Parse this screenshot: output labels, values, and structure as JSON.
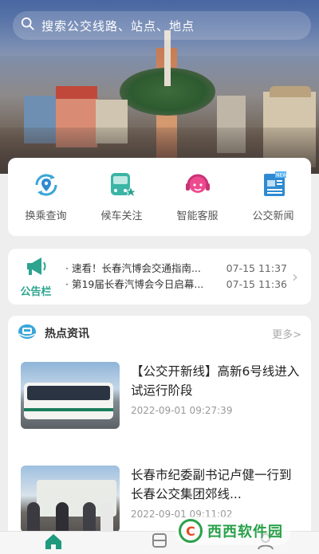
{
  "search": {
    "placeholder": "搜索公交线路、站点、地点"
  },
  "quick_actions": [
    {
      "label": "换乘查询",
      "icon": "transfer-location-icon"
    },
    {
      "label": "候车关注",
      "icon": "bus-star-icon"
    },
    {
      "label": "智能客服",
      "icon": "headset-service-icon"
    },
    {
      "label": "公交新闻",
      "icon": "newspaper-icon"
    }
  ],
  "notice": {
    "label": "公告栏",
    "items": [
      {
        "text": "· 速看！长春汽博会交通指南...",
        "time": "07-15 11:37"
      },
      {
        "text": "· 第19届长春汽博会今日启幕...",
        "time": "07-15 11:36"
      }
    ]
  },
  "news": {
    "title": "热点资讯",
    "more": "更多>",
    "items": [
      {
        "headline": "【公交开新线】高新6号线进入试运行阶段",
        "date": "2022-09-01 09:27:39"
      },
      {
        "headline": "长春市纪委副书记卢健一行到长春公交集团郊线...",
        "date": "2022-09-01 09:11:02"
      }
    ]
  },
  "tabbar": {
    "tabs": [
      "home-icon",
      "bus-icon",
      "profile-icon"
    ]
  },
  "watermark": {
    "text": "西西软件园"
  },
  "colors": {
    "accent": "#2ca48f",
    "teal": "#3bb5a5",
    "pink": "#ee4a8f",
    "blue": "#2f8ad1"
  }
}
